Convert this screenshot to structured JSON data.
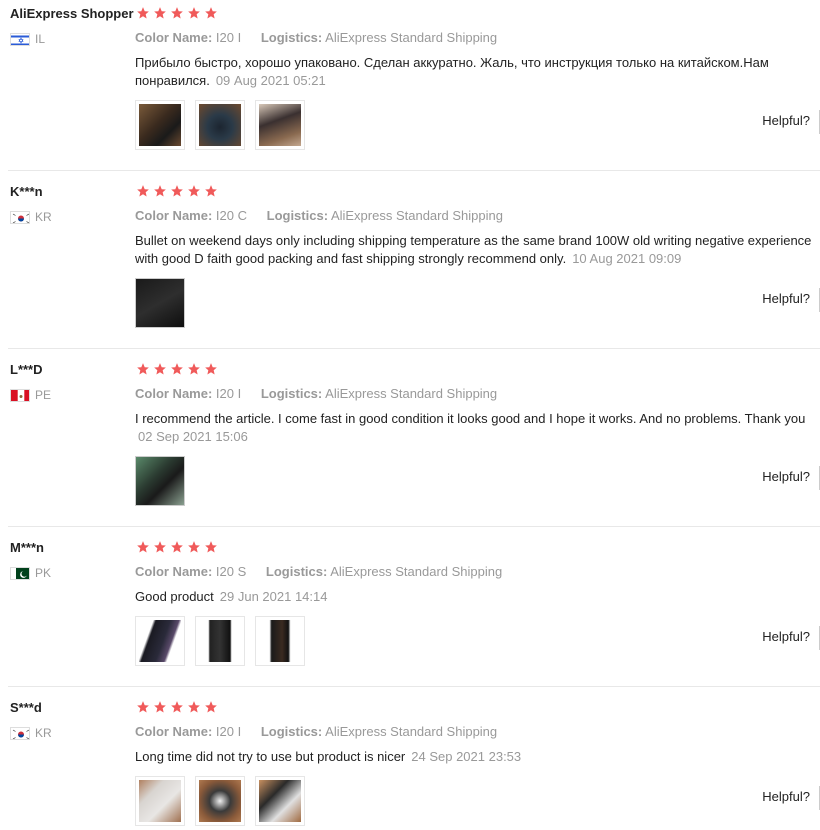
{
  "reviews": [
    {
      "name": "AliExpress Shopper",
      "country": "IL",
      "color_label": "Color Name:",
      "color_value": "I20 I",
      "logistics_label": "Logistics:",
      "logistics_value": "AliExpress Standard Shipping",
      "text_line1": "Прибыло быстро, хорошо упаковано. Сделан аккуратно. Жаль, что инструкция только на китайском.Нам",
      "text_line2": "понравился.",
      "date": "09 Aug 2021 05:21",
      "helpful": "Helpful?",
      "rating": 5,
      "photos": 3
    },
    {
      "name": "K***n",
      "country": "KR",
      "color_label": "Color Name:",
      "color_value": "I20 C",
      "logistics_label": "Logistics:",
      "logistics_value": "AliExpress Standard Shipping",
      "text_line1": "Bullet on weekend days only including shipping temperature as the same brand 100W old writing negative experience",
      "text_line2": "with good D faith good packing and fast shipping strongly recommend only.",
      "date": "10 Aug 2021 09:09",
      "helpful": "Helpful?",
      "rating": 5,
      "photos": 1
    },
    {
      "name": "L***D",
      "country": "PE",
      "color_label": "Color Name:",
      "color_value": "I20 I",
      "logistics_label": "Logistics:",
      "logistics_value": "AliExpress Standard Shipping",
      "text_line1": "I recommend the article. I come fast in good condition it looks good and I hope it works. And no problems. Thank you",
      "text_line2": "",
      "date": "02 Sep 2021 15:06",
      "helpful": "Helpful?",
      "rating": 5,
      "photos": 1
    },
    {
      "name": "M***n",
      "country": "PK",
      "color_label": "Color Name:",
      "color_value": "I20 S",
      "logistics_label": "Logistics:",
      "logistics_value": "AliExpress Standard Shipping",
      "text_line1": "Good product",
      "text_line2": "",
      "date": "29 Jun 2021 14:14",
      "helpful": "Helpful?",
      "rating": 5,
      "photos": 3
    },
    {
      "name": "S***d",
      "country": "KR",
      "color_label": "Color Name:",
      "color_value": "I20 I",
      "logistics_label": "Logistics:",
      "logistics_value": "AliExpress Standard Shipping",
      "text_line1": "Long time did not try to use but product is nicer",
      "text_line2": "",
      "date": "24 Sep 2021 23:53",
      "helpful": "Helpful?",
      "rating": 5,
      "photos": 3
    }
  ],
  "colors": {
    "star": "#f05a5a",
    "muted": "#999999",
    "text": "#222222"
  }
}
